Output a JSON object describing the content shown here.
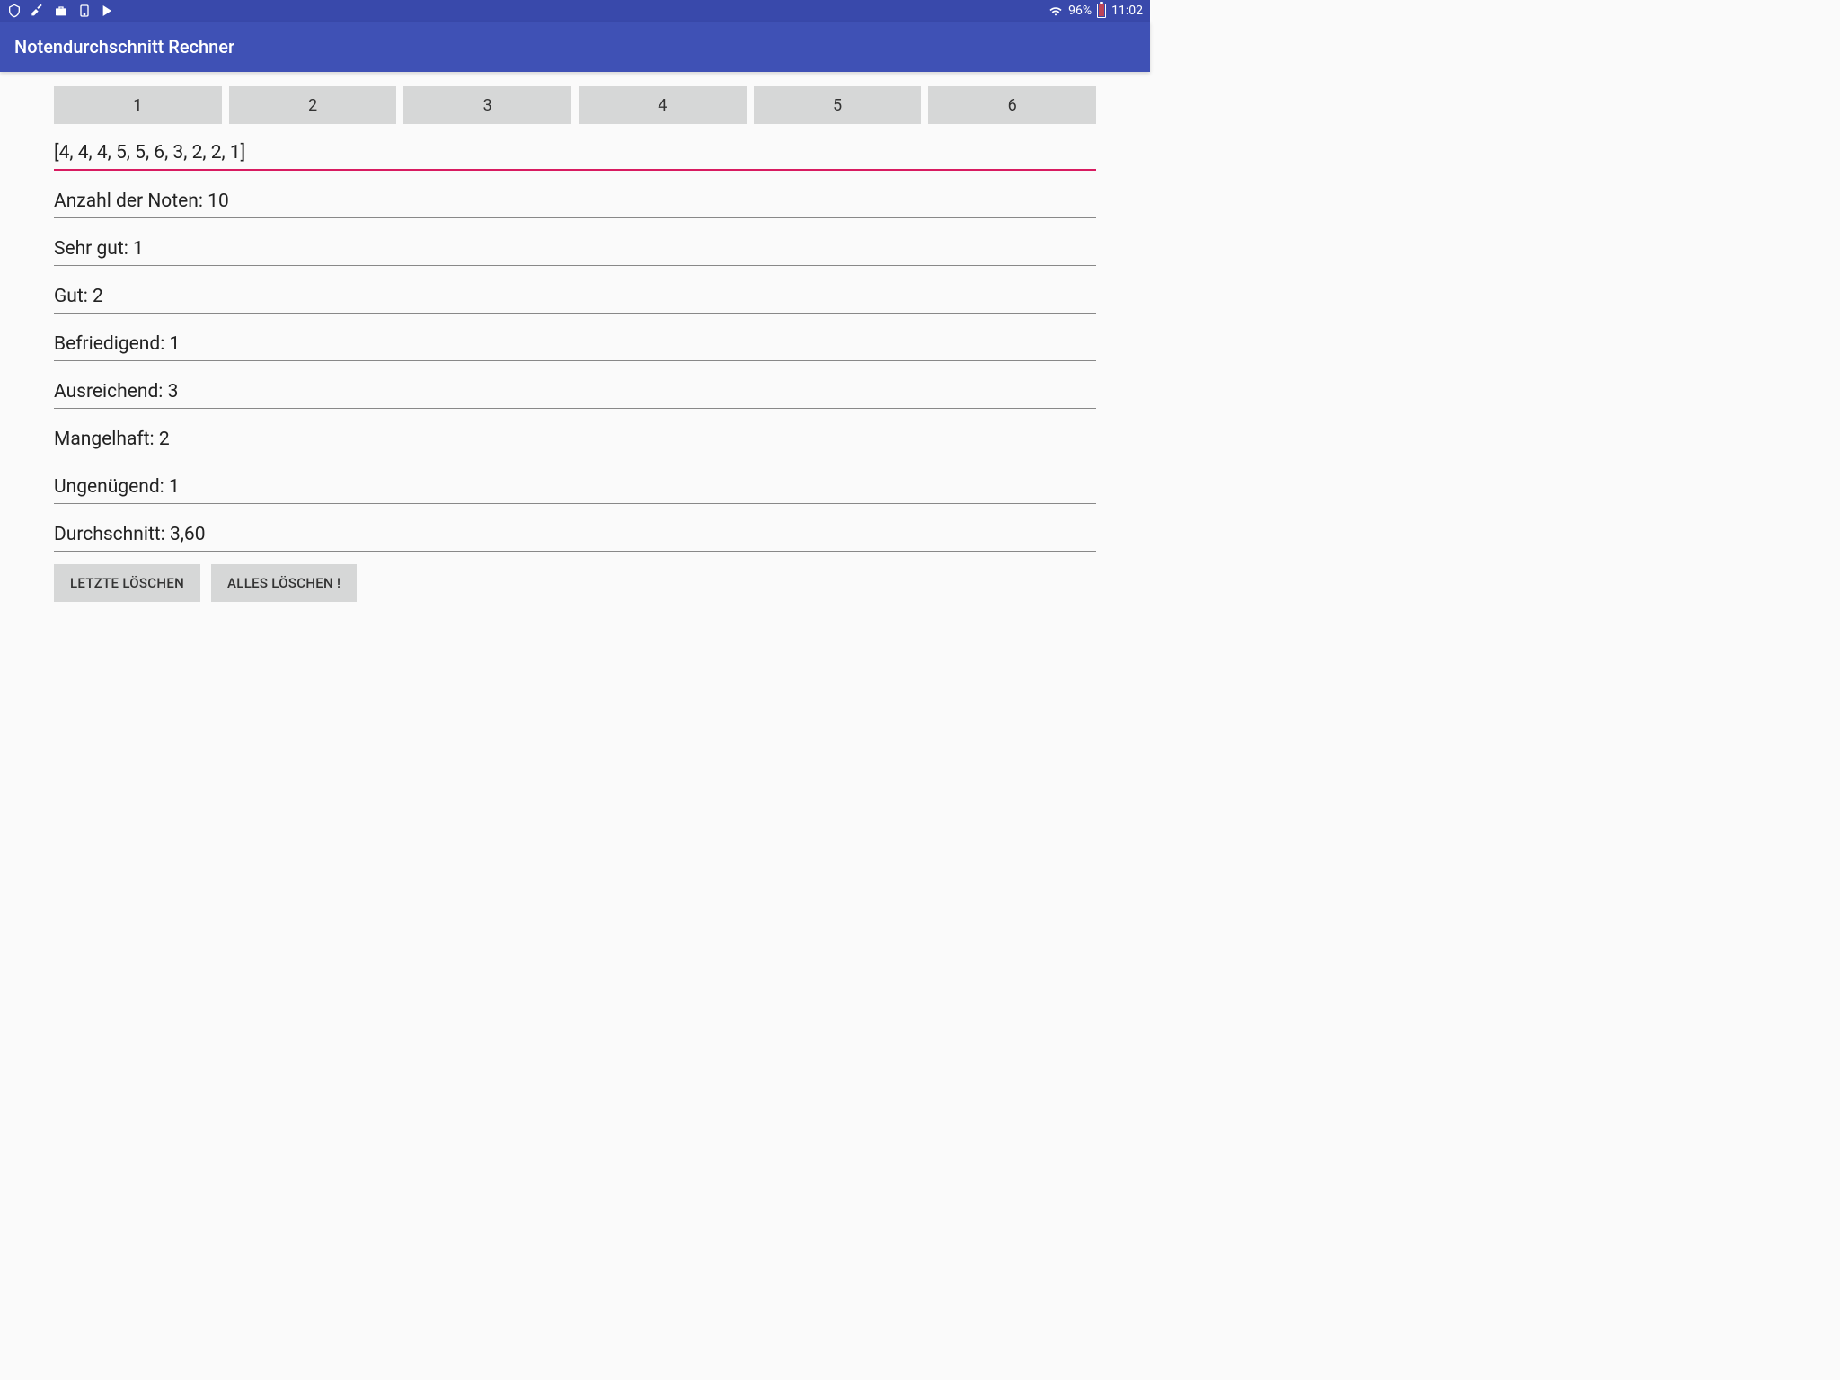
{
  "status": {
    "battery_pct": "96%",
    "time": "11:02"
  },
  "app": {
    "title": "Notendurchschnitt Rechner"
  },
  "grades": {
    "buttons": [
      "1",
      "2",
      "3",
      "4",
      "5",
      "6"
    ],
    "entered_list": "[4, 4, 4, 5, 5, 6, 3, 2, 2, 1]"
  },
  "stats": {
    "count": "Anzahl der Noten: 10",
    "sehr_gut": "Sehr gut: 1",
    "gut": "Gut: 2",
    "befriedigend": "Befriedigend: 1",
    "ausreichend": "Ausreichend: 3",
    "mangelhaft": "Mangelhaft: 2",
    "ungenuegend": "Ungenügend: 1",
    "durchschnitt": "Durchschnitt: 3,60"
  },
  "actions": {
    "delete_last": "LETZTE LÖSCHEN",
    "delete_all": "ALLES LÖSCHEN !"
  }
}
